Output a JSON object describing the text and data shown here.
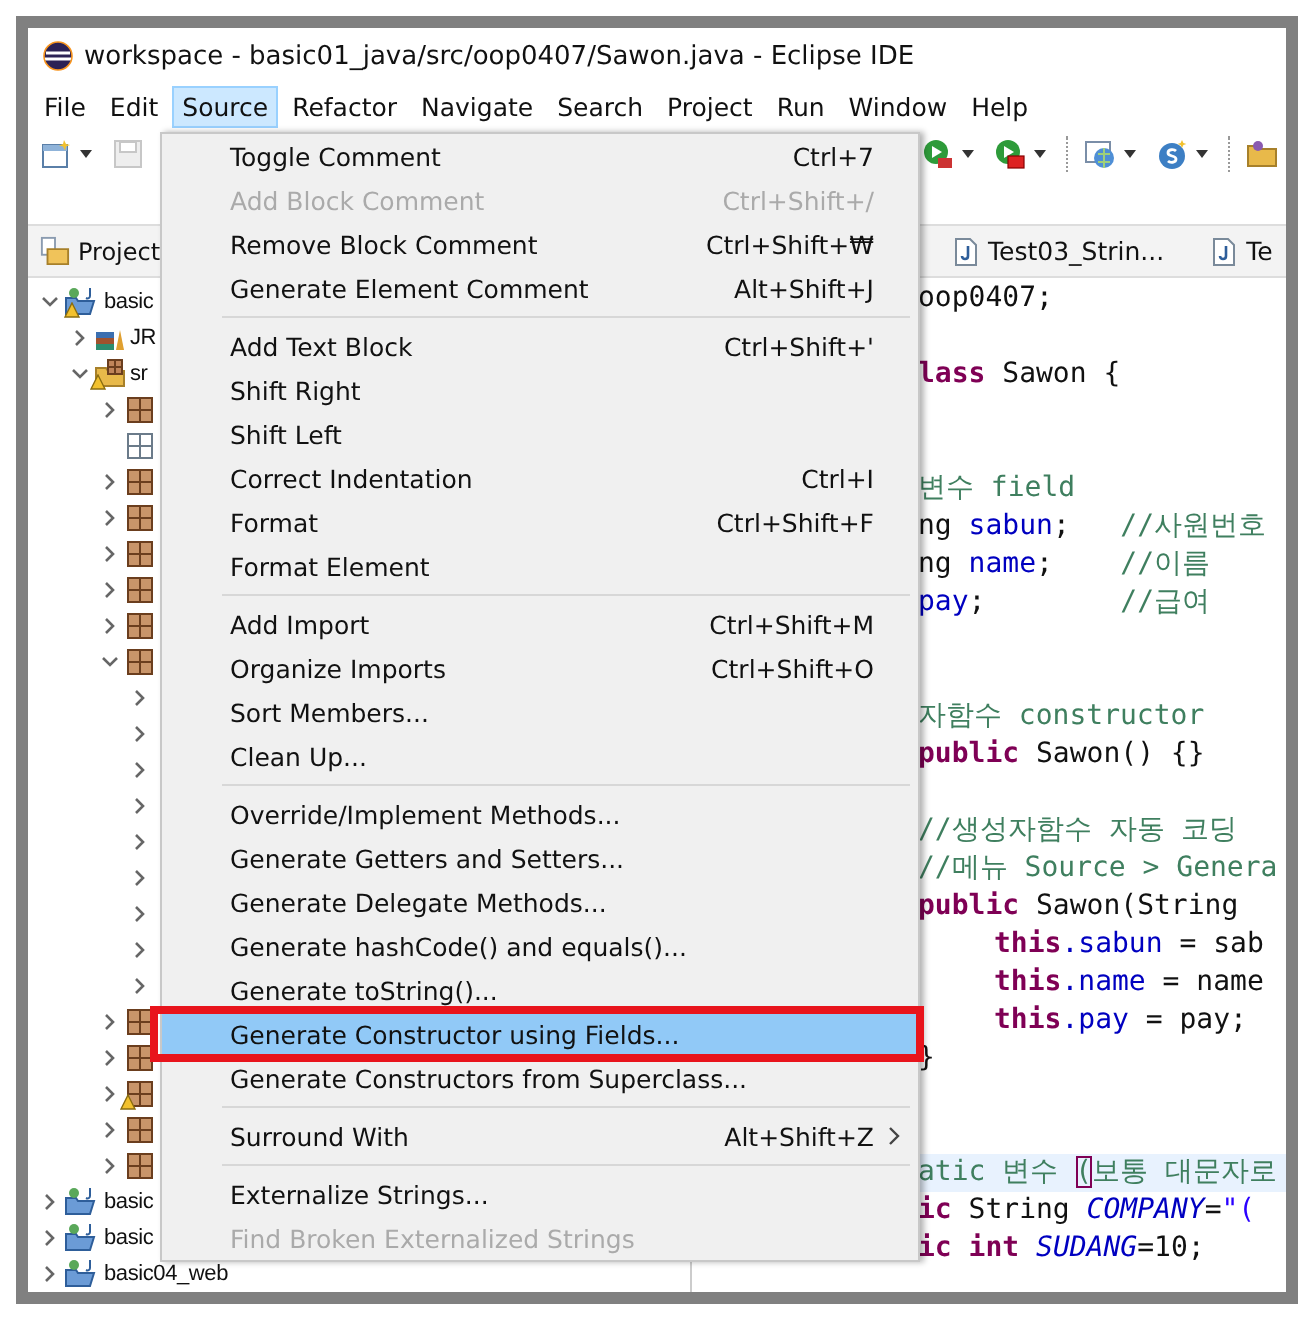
{
  "window": {
    "title": "workspace - basic01_java/src/oop0407/Sawon.java - Eclipse IDE"
  },
  "menubar": [
    {
      "label": "File",
      "selected": false
    },
    {
      "label": "Edit",
      "selected": false
    },
    {
      "label": "Source",
      "selected": true
    },
    {
      "label": "Refactor",
      "selected": false
    },
    {
      "label": "Navigate",
      "selected": false
    },
    {
      "label": "Search",
      "selected": false
    },
    {
      "label": "Project",
      "selected": false
    },
    {
      "label": "Run",
      "selected": false
    },
    {
      "label": "Window",
      "selected": false
    },
    {
      "label": "Help",
      "selected": false
    }
  ],
  "explorer": {
    "tab": "Project",
    "tree": [
      {
        "kind": "project",
        "label": "basic",
        "expanded": true,
        "warning": true,
        "children": [
          {
            "kind": "library",
            "label": "JR",
            "expanded": false,
            "warning": false
          },
          {
            "kind": "source-folder",
            "label": "sr",
            "expanded": true,
            "warning": true,
            "children": [
              {
                "kind": "package",
                "expanded": false,
                "warning": false
              },
              {
                "kind": "empty-package",
                "warning": false
              },
              {
                "kind": "package",
                "expanded": false,
                "warning": false
              },
              {
                "kind": "package",
                "expanded": false,
                "warning": false
              },
              {
                "kind": "package",
                "expanded": false,
                "warning": false
              },
              {
                "kind": "package",
                "expanded": false,
                "warning": false
              },
              {
                "kind": "package",
                "expanded": false,
                "warning": false
              },
              {
                "kind": "package",
                "expanded": true,
                "warning": false,
                "children": [
                  {
                    "expanded": false
                  },
                  {
                    "expanded": false
                  },
                  {
                    "expanded": false
                  },
                  {
                    "expanded": false
                  },
                  {
                    "expanded": false
                  },
                  {
                    "expanded": false
                  },
                  {
                    "expanded": false
                  },
                  {
                    "expanded": false
                  },
                  {
                    "expanded": false
                  }
                ]
              },
              {
                "kind": "package",
                "expanded": false,
                "warning": false
              },
              {
                "kind": "package",
                "expanded": false,
                "warning": false
              },
              {
                "kind": "package",
                "expanded": false,
                "warning": true
              },
              {
                "kind": "package",
                "expanded": false,
                "warning": false
              },
              {
                "kind": "package",
                "expanded": false,
                "warning": false
              }
            ]
          }
        ]
      },
      {
        "kind": "project",
        "label": "basic",
        "expanded": false,
        "warning": false
      },
      {
        "kind": "project",
        "label": "basic",
        "expanded": false,
        "warning": false
      },
      {
        "kind": "project",
        "label": "basic04_web",
        "expanded": false,
        "warning": false
      }
    ]
  },
  "editor": {
    "tabs": [
      {
        "label": "Test03_Strin...",
        "selected": false
      },
      {
        "label": "Te",
        "selected": false
      }
    ],
    "lines": [
      {
        "kind": "code",
        "current": false,
        "indented": false,
        "segs": [
          {
            "kind": "plain",
            "t": "oop0407;"
          }
        ]
      },
      {
        "kind": "blank"
      },
      {
        "kind": "code",
        "current": false,
        "indented": false,
        "segs": [
          {
            "kind": "keyword",
            "t": "lass"
          },
          {
            "kind": "plain",
            "t": " Sawon {"
          }
        ]
      },
      {
        "kind": "blank"
      },
      {
        "kind": "blank"
      },
      {
        "kind": "code",
        "current": false,
        "indented": false,
        "segs": [
          {
            "kind": "comment",
            "t": "변수 field"
          }
        ]
      },
      {
        "kind": "code",
        "current": false,
        "indented": false,
        "segs": [
          {
            "kind": "plain",
            "t": "ng "
          },
          {
            "kind": "field",
            "t": "sabun"
          },
          {
            "kind": "plain",
            "t": ";   "
          },
          {
            "kind": "comment",
            "t": "//사원번호"
          }
        ]
      },
      {
        "kind": "code",
        "current": false,
        "indented": false,
        "segs": [
          {
            "kind": "plain",
            "t": "ng "
          },
          {
            "kind": "field",
            "t": "name"
          },
          {
            "kind": "plain",
            "t": ";    "
          },
          {
            "kind": "comment",
            "t": "//이름"
          }
        ]
      },
      {
        "kind": "code",
        "current": false,
        "indented": false,
        "segs": [
          {
            "kind": "field",
            "t": "pay"
          },
          {
            "kind": "plain",
            "t": ";        "
          },
          {
            "kind": "comment",
            "t": "//급여"
          }
        ]
      },
      {
        "kind": "blank"
      },
      {
        "kind": "blank"
      },
      {
        "kind": "code",
        "current": false,
        "indented": false,
        "segs": [
          {
            "kind": "comment",
            "t": "자함수 constructor"
          }
        ]
      },
      {
        "kind": "code",
        "current": false,
        "indented": false,
        "segs": [
          {
            "kind": "keyword",
            "t": "public"
          },
          {
            "kind": "plain",
            "t": " Sawon() {}"
          }
        ]
      },
      {
        "kind": "blank"
      },
      {
        "kind": "code",
        "current": false,
        "indented": false,
        "segs": [
          {
            "kind": "comment",
            "t": "//생성자함수 자동 코딩"
          }
        ]
      },
      {
        "kind": "code",
        "current": false,
        "indented": false,
        "segs": [
          {
            "kind": "comment",
            "t": "//메뉴 Source > Genera"
          }
        ]
      },
      {
        "kind": "code",
        "current": false,
        "indented": false,
        "segs": [
          {
            "kind": "keyword",
            "t": "public"
          },
          {
            "kind": "plain",
            "t": " Sawon(String"
          }
        ]
      },
      {
        "kind": "code",
        "current": false,
        "indented": true,
        "segs": [
          {
            "kind": "keyword",
            "t": "this"
          },
          {
            "kind": "field",
            "t": ".sabun"
          },
          {
            "kind": "plain",
            "t": " = sab"
          }
        ]
      },
      {
        "kind": "code",
        "current": false,
        "indented": true,
        "segs": [
          {
            "kind": "keyword",
            "t": "this"
          },
          {
            "kind": "field",
            "t": ".name"
          },
          {
            "kind": "plain",
            "t": " = name"
          }
        ]
      },
      {
        "kind": "code",
        "current": false,
        "indented": true,
        "segs": [
          {
            "kind": "keyword",
            "t": "this"
          },
          {
            "kind": "field",
            "t": ".pay"
          },
          {
            "kind": "plain",
            "t": " = pay;"
          }
        ]
      },
      {
        "kind": "code",
        "current": false,
        "indented": false,
        "segs": [
          {
            "kind": "plain",
            "t": "}"
          }
        ]
      },
      {
        "kind": "blank"
      },
      {
        "kind": "blank"
      },
      {
        "kind": "code",
        "current": true,
        "indented": false,
        "segs": [
          {
            "kind": "comment",
            "t": "atic 변수 "
          },
          {
            "kind": "bracket",
            "t": "("
          },
          {
            "kind": "comment",
            "t": "보통 대문자로"
          }
        ]
      },
      {
        "kind": "code",
        "current": false,
        "indented": false,
        "segs": [
          {
            "kind": "keyword",
            "t": "ic"
          },
          {
            "kind": "plain",
            "t": " String "
          },
          {
            "kind": "static",
            "t": "COMPANY"
          },
          {
            "kind": "plain",
            "t": "="
          },
          {
            "kind": "string",
            "t": "\"("
          }
        ]
      },
      {
        "kind": "code",
        "current": false,
        "indented": false,
        "segs": [
          {
            "kind": "keyword",
            "t": "ic "
          },
          {
            "kind": "keyword",
            "t": "int "
          },
          {
            "kind": "static",
            "t": "SUDANG"
          },
          {
            "kind": "plain",
            "t": "=10;"
          }
        ]
      }
    ]
  },
  "source_menu": [
    {
      "kind": "item",
      "label": "Toggle Comment",
      "shortcut": "Ctrl+7",
      "disabled": false,
      "selected": false,
      "outlined": false,
      "submenu": false
    },
    {
      "kind": "item",
      "label": "Add Block Comment",
      "shortcut": "Ctrl+Shift+/",
      "disabled": true,
      "selected": false,
      "outlined": false,
      "submenu": false
    },
    {
      "kind": "item",
      "label": "Remove Block Comment",
      "shortcut": "Ctrl+Shift+₩",
      "disabled": false,
      "selected": false,
      "outlined": false,
      "submenu": false
    },
    {
      "kind": "item",
      "label": "Generate Element Comment",
      "shortcut": "Alt+Shift+J",
      "disabled": false,
      "selected": false,
      "outlined": false,
      "submenu": false
    },
    {
      "kind": "separator"
    },
    {
      "kind": "item",
      "label": "Add Text Block",
      "shortcut": "Ctrl+Shift+'",
      "disabled": false,
      "selected": false,
      "outlined": false,
      "submenu": false
    },
    {
      "kind": "item",
      "label": "Shift Right",
      "disabled": false,
      "selected": false,
      "outlined": false,
      "submenu": false
    },
    {
      "kind": "item",
      "label": "Shift Left",
      "disabled": false,
      "selected": false,
      "outlined": false,
      "submenu": false
    },
    {
      "kind": "item",
      "label": "Correct Indentation",
      "shortcut": "Ctrl+I",
      "disabled": false,
      "selected": false,
      "outlined": false,
      "submenu": false
    },
    {
      "kind": "item",
      "label": "Format",
      "shortcut": "Ctrl+Shift+F",
      "disabled": false,
      "selected": false,
      "outlined": false,
      "submenu": false
    },
    {
      "kind": "item",
      "label": "Format Element",
      "disabled": false,
      "selected": false,
      "outlined": false,
      "submenu": false
    },
    {
      "kind": "separator"
    },
    {
      "kind": "item",
      "label": "Add Import",
      "shortcut": "Ctrl+Shift+M",
      "disabled": false,
      "selected": false,
      "outlined": false,
      "submenu": false
    },
    {
      "kind": "item",
      "label": "Organize Imports",
      "shortcut": "Ctrl+Shift+O",
      "disabled": false,
      "selected": false,
      "outlined": false,
      "submenu": false
    },
    {
      "kind": "item",
      "label": "Sort Members...",
      "disabled": false,
      "selected": false,
      "outlined": false,
      "submenu": false
    },
    {
      "kind": "item",
      "label": "Clean Up...",
      "disabled": false,
      "selected": false,
      "outlined": false,
      "submenu": false
    },
    {
      "kind": "separator"
    },
    {
      "kind": "item",
      "label": "Override/Implement Methods...",
      "disabled": false,
      "selected": false,
      "outlined": false,
      "submenu": false
    },
    {
      "kind": "item",
      "label": "Generate Getters and Setters...",
      "disabled": false,
      "selected": false,
      "outlined": false,
      "submenu": false
    },
    {
      "kind": "item",
      "label": "Generate Delegate Methods...",
      "disabled": false,
      "selected": false,
      "outlined": false,
      "submenu": false
    },
    {
      "kind": "item",
      "label": "Generate hashCode() and equals()...",
      "disabled": false,
      "selected": false,
      "outlined": false,
      "submenu": false
    },
    {
      "kind": "item",
      "label": "Generate toString()...",
      "disabled": false,
      "selected": false,
      "outlined": false,
      "submenu": false
    },
    {
      "kind": "item",
      "label": "Generate Constructor using Fields...",
      "disabled": false,
      "selected": true,
      "outlined": true,
      "submenu": false
    },
    {
      "kind": "item",
      "label": "Generate Constructors from Superclass...",
      "disabled": false,
      "selected": false,
      "outlined": false,
      "submenu": false
    },
    {
      "kind": "separator"
    },
    {
      "kind": "item",
      "label": "Surround With",
      "shortcut": "Alt+Shift+Z",
      "disabled": false,
      "selected": false,
      "outlined": false,
      "submenu": true
    },
    {
      "kind": "separator"
    },
    {
      "kind": "item",
      "label": "Externalize Strings...",
      "disabled": false,
      "selected": false,
      "outlined": false,
      "submenu": false
    },
    {
      "kind": "item",
      "label": "Find Broken Externalized Strings",
      "disabled": true,
      "selected": false,
      "outlined": false,
      "submenu": false
    }
  ]
}
